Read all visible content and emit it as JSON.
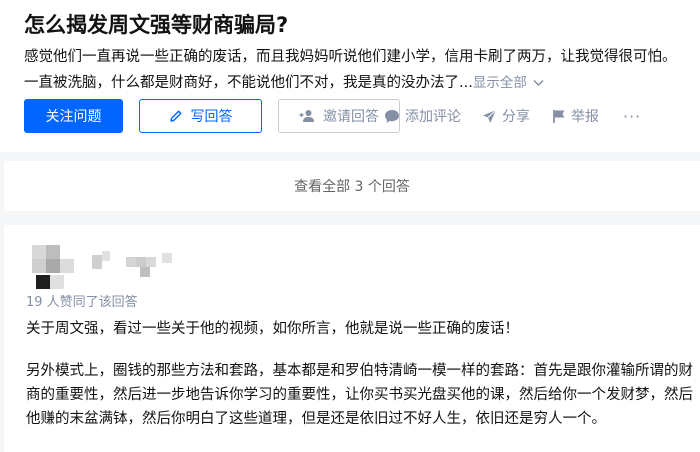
{
  "question": {
    "title": "怎么揭发周文强等财商骗局?",
    "description": "感觉他们一直再说一些正确的废话，而且我妈妈听说他们建小学，信用卡刷了两万，让我觉得很可怕。一直被洗脑，什么都是财商好，不能说他们不对，我是真的没办法了...",
    "show_all": "显示全部",
    "buttons": {
      "follow": "关注问题",
      "write_answer": "写回答",
      "invite": "邀请回答"
    },
    "actions": {
      "comment": "添加评论",
      "share": "分享",
      "report": "举报",
      "more": "···"
    }
  },
  "view_all": "查看全部 3 个回答",
  "answer": {
    "upvote_text": "19 人赞同了该回答",
    "paragraphs": [
      "关于周文强，看过一些关于他的视频，如你所言，他就是说一些正确的废话！",
      "另外模式上，圈钱的那些方法和套路，基本都是和罗伯特清崎一模一样的套路：首先是跟你灌输所谓的财商的重要性，然后进一步地告诉你学习的重要性，让你买书买光盘买他的课，然后给你一个发财梦，然后他赚的末盆满钵，然后你明白了这些道理，但是还是依旧过不好人生，依旧还是穷人一个。"
    ]
  },
  "colors": {
    "primary": "#0066ff",
    "muted": "#8590a6",
    "text": "#121212",
    "page_bg": "#f5f6f7"
  },
  "icons": {
    "write": "pencil-icon",
    "invite": "add-user-icon",
    "comment": "comment-bubble-icon",
    "share": "paper-plane-icon",
    "report": "flag-icon",
    "show_all": "chevron-down-icon"
  }
}
